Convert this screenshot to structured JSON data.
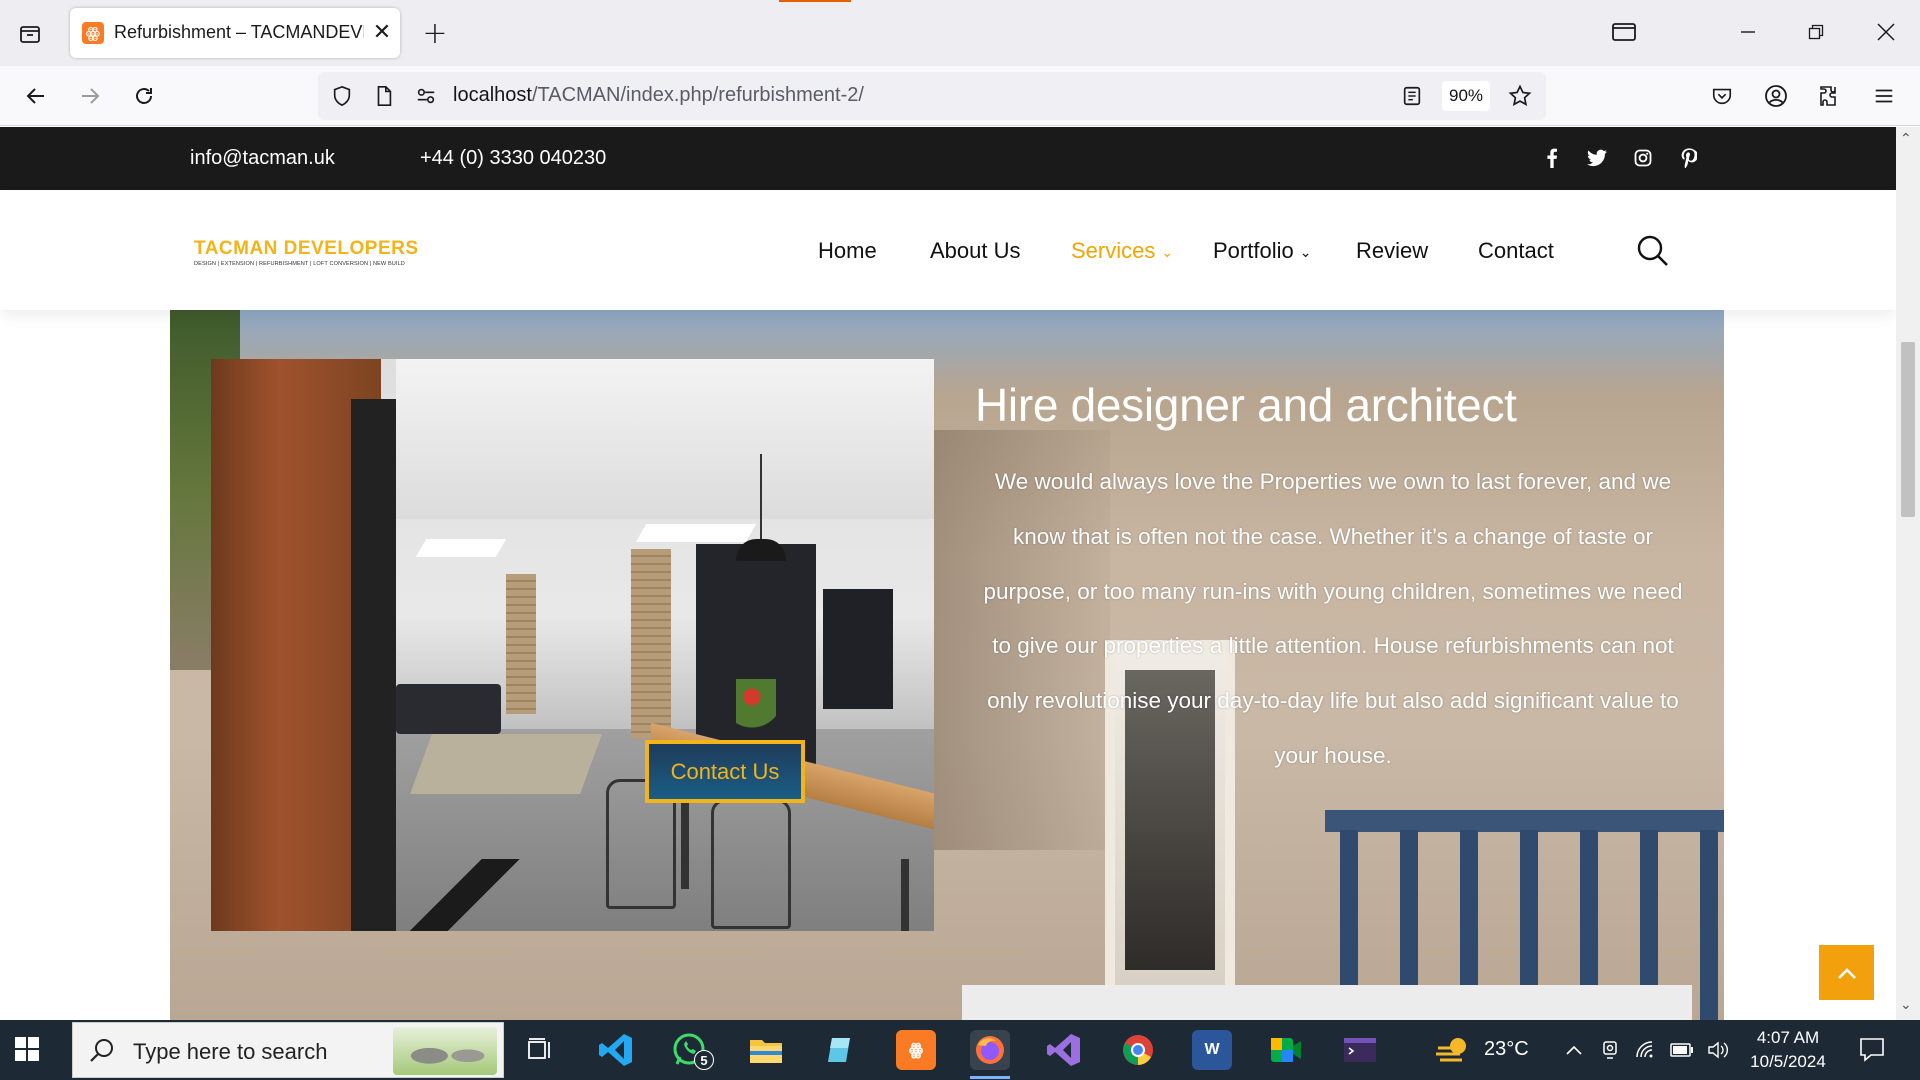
{
  "browser": {
    "tab_title": "Refurbishment – TACMANDEVELOPERS",
    "url_host": "localhost",
    "url_path": "/TACMAN/index.php/refurbishment-2/",
    "zoom": "90%"
  },
  "site": {
    "email": "info@tacman.uk",
    "phone": "+44 (0)  3330 040230",
    "social": [
      "facebook-icon",
      "twitter-icon",
      "instagram-icon",
      "pinterest-icon"
    ],
    "logo_brand": "TACMAN DEVELOPERS",
    "logo_tagline": "DESIGN | EXTENSION | REFURBISHMENT | LOFT CONVERSION | NEW BUILD",
    "menu": [
      {
        "label": "Home"
      },
      {
        "label": "About Us"
      },
      {
        "label": "Services"
      },
      {
        "label": "Portfolio"
      },
      {
        "label": "Review"
      },
      {
        "label": "Contact"
      }
    ],
    "accent_color": "#f2b31b"
  },
  "hero": {
    "title": "Hire designer and architect",
    "body": "We would always love the Properties we own to last forever, and we know that is often not the case. Whether it’s a change of taste or purpose, or too many run-ins with young children, sometimes we need to give our properties a little attention. House refurbishments can not only revolutionise your day-to-day life but also add significant value to your house.",
    "cta_label": "Contact Us"
  },
  "taskbar": {
    "search_placeholder": "Type here to search",
    "whatsapp_badge": "5",
    "temperature": "23°C",
    "time": "4:07 AM",
    "date": "10/5/2024"
  }
}
